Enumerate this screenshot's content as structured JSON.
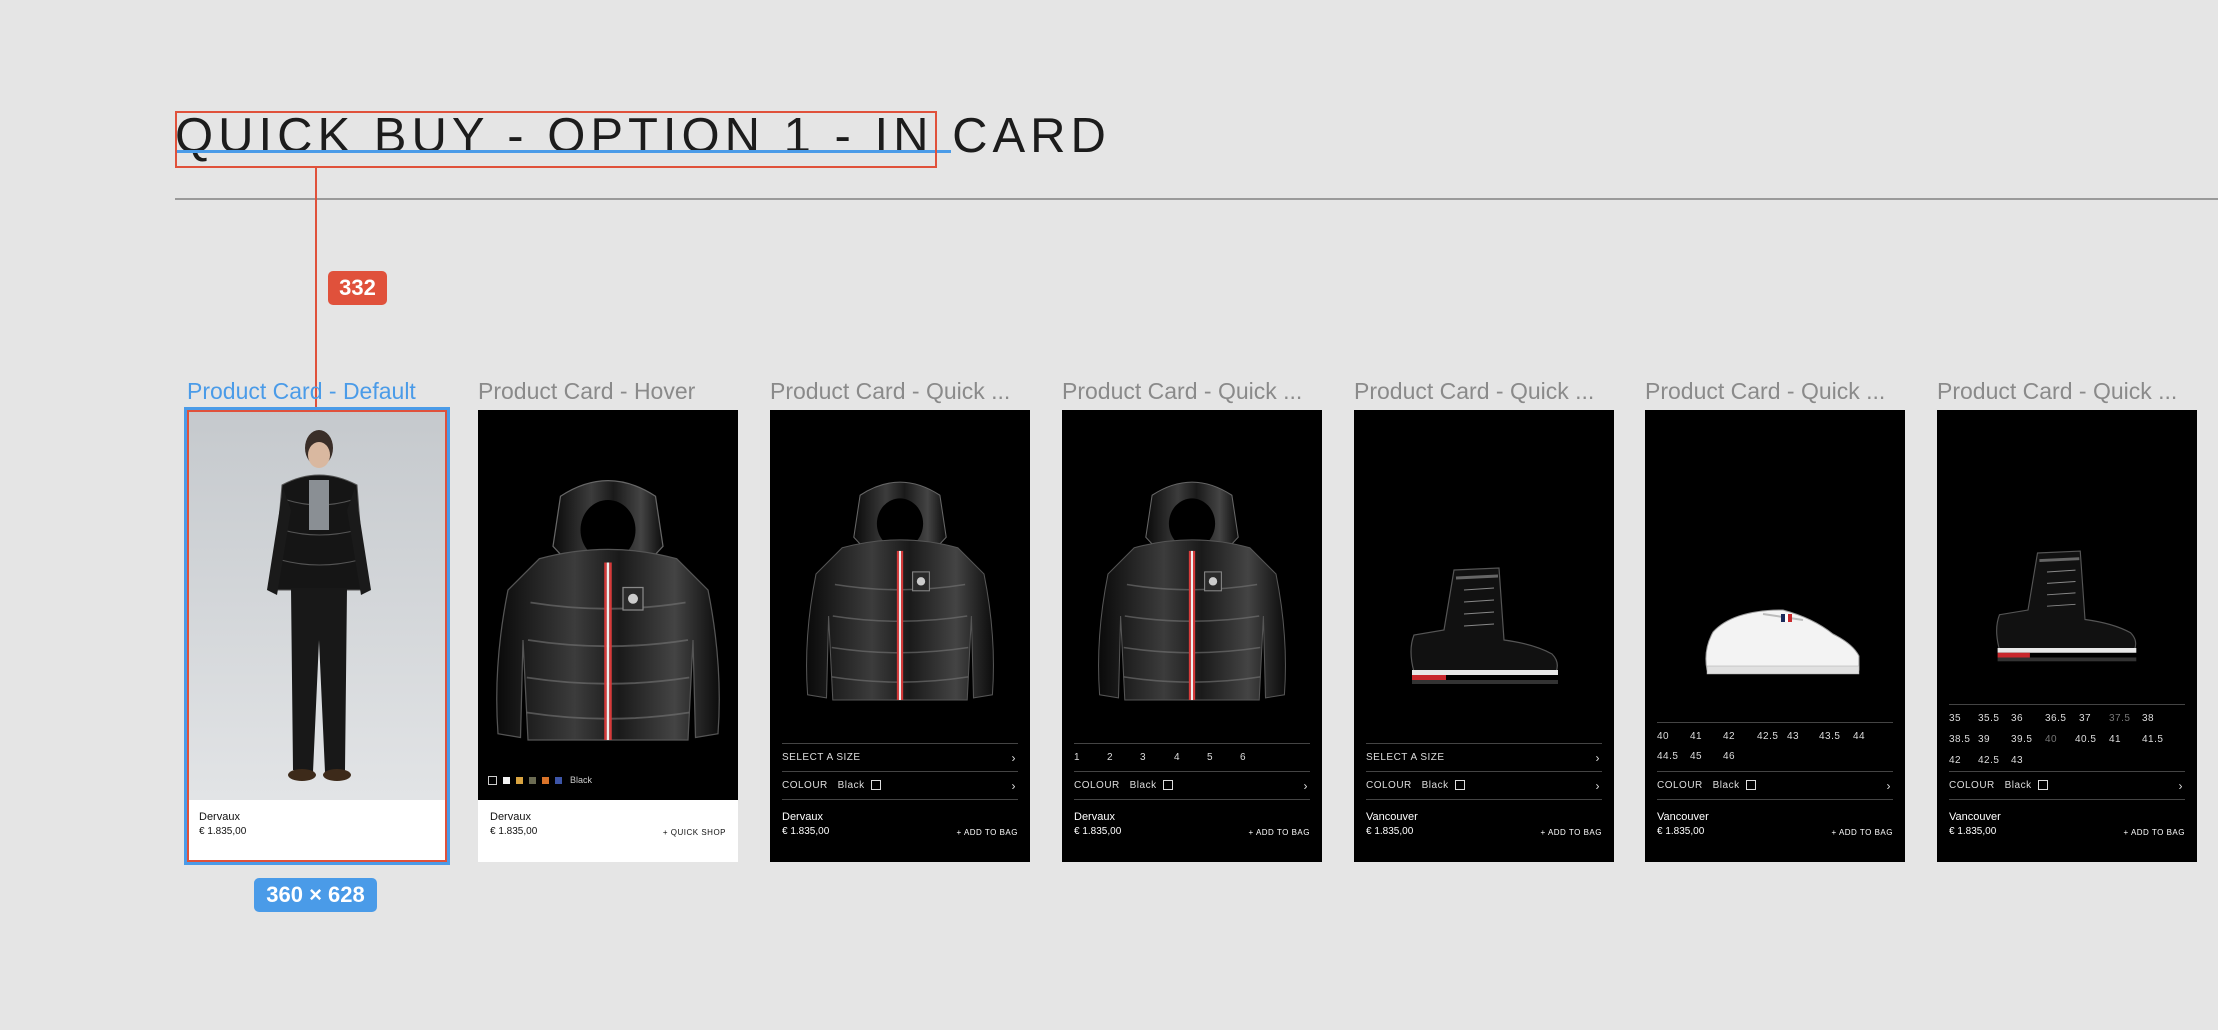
{
  "header": {
    "title": "QUICK BUY - OPTION 1 - IN CARD",
    "distance_badge": "332",
    "size_badge": "360 × 628"
  },
  "colors": {
    "accent_blue": "#4a9be8",
    "accent_red": "#e0513b",
    "card_black": "#000000",
    "canvas": "#e5e5e5"
  },
  "frames": [
    {
      "label": "Product Card - Default",
      "name": "Dervaux",
      "price": "€ 1.835,00"
    },
    {
      "label": "Product Card - Hover",
      "name": "Dervaux",
      "price": "€ 1.835,00",
      "cta": "+ QUICK SHOP",
      "colour_name": "Black"
    },
    {
      "label": "Product Card - Quick ...",
      "select_size": "SELECT A SIZE",
      "colour_label": "COLOUR",
      "colour_value": "Black",
      "name": "Dervaux",
      "price": "€ 1.835,00",
      "cta": "+ ADD TO BAG"
    },
    {
      "label": "Product Card - Quick ...",
      "sizes": [
        "1",
        "2",
        "3",
        "4",
        "5",
        "6"
      ],
      "colour_label": "COLOUR",
      "colour_value": "Black",
      "name": "Dervaux",
      "price": "€ 1.835,00",
      "cta": "+ ADD TO BAG"
    },
    {
      "label": "Product Card - Quick ...",
      "select_size": "SELECT A SIZE",
      "colour_label": "COLOUR",
      "colour_value": "Black",
      "name": "Vancouver",
      "price": "€ 1.835,00",
      "cta": "+ ADD TO BAG"
    },
    {
      "label": "Product Card - Quick ...",
      "sizes": [
        "40",
        "41",
        "42",
        "42.5",
        "43",
        "43.5",
        "44",
        "44.5",
        "45",
        "46"
      ],
      "colour_label": "COLOUR",
      "colour_value": "Black",
      "name": "Vancouver",
      "price": "€ 1.835,00",
      "cta": "+ ADD TO BAG"
    },
    {
      "label": "Product Card - Quick ...",
      "sizes": [
        "35",
        "35.5",
        "36",
        "36.5",
        "37",
        "37.5",
        "38",
        "38.5",
        "39",
        "39.5",
        "40",
        "40.5",
        "41",
        "41.5",
        "42",
        "42.5",
        "43"
      ],
      "colour_label": "COLOUR",
      "colour_value": "Black",
      "name": "Vancouver",
      "price": "€ 1.835,00",
      "cta": "+ ADD TO BAG"
    }
  ]
}
